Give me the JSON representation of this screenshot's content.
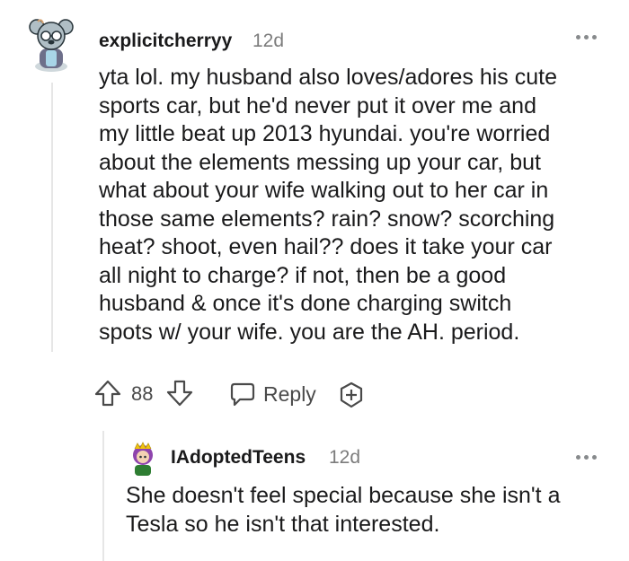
{
  "comment": {
    "username": "explicitcherryy",
    "age": "12d",
    "avatar_icon": "koala-avatar-icon",
    "body": "yta lol. my husband also loves/adores his cute\nsports car, but he'd never put it over me and\nmy little beat up 2013 hyundai. you're worried\nabout the elements messing up your car, but\nwhat about your wife walking out to her car in\nthose same elements? rain? snow? scorching\nheat? shoot, even hail?? does it take your car\nall night to charge? if not, then be a good\nhusband & once it's done charging switch\nspots w/ your wife. you are the AH. period.",
    "score": "88",
    "reply_label": "Reply",
    "icons": {
      "upvote": "upvote-arrow-icon",
      "downvote": "downvote-arrow-icon",
      "reply": "speech-bubble-icon",
      "award": "award-plus-icon",
      "more": "more-options-icon"
    }
  },
  "reply": {
    "username": "IAdoptedTeens",
    "age": "12d",
    "avatar_icon": "purple-hair-avatar-icon",
    "body": "She doesn't feel special because she isn't a\nTesla so he isn't that interested."
  },
  "colors": {
    "text": "#1a1a1b",
    "meta": "#7c7c7c",
    "icon": "#4a4a4a",
    "thread_line": "#e6e6e6"
  }
}
